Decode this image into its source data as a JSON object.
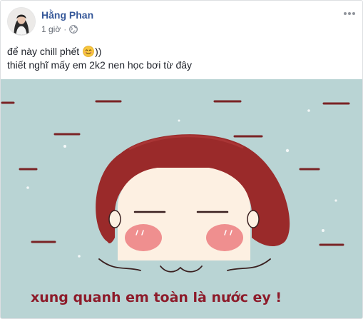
{
  "post": {
    "author": {
      "name": "Hằng Phan",
      "avatar_icon": "profile-photo"
    },
    "meta": {
      "timestamp": "1 giờ",
      "separator": "·",
      "privacy_icon": "globe-icon"
    },
    "menu_icon": "more-horizontal-icon",
    "text": {
      "line1_before_emoji": "để này chill phết ",
      "line1_emoji": "smiling-face-emoji",
      "line1_after_emoji": "))",
      "line2": "thiết nghĩ mấy em 2k2 nen học bơi từ đây"
    },
    "image": {
      "caption": "xung quanh em toàn là nước ey !",
      "colors": {
        "water": "#b9d4d4",
        "hair": "#9a2a2a",
        "blush": "#ef8f8f",
        "text": "#8d1b2a"
      }
    }
  },
  "colors": {
    "name_link": "#365899",
    "meta": "#616770",
    "body_text": "#1d2129"
  }
}
